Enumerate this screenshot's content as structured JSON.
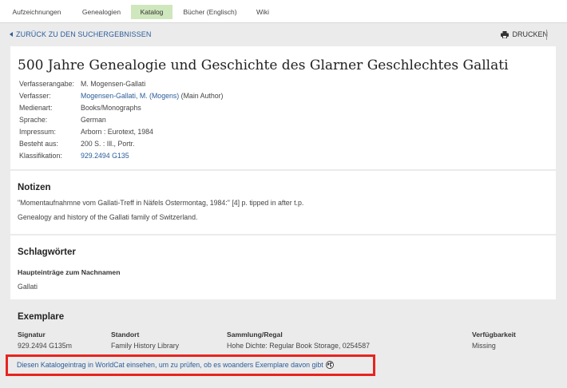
{
  "tabs": [
    {
      "label": "Aufzeichnungen"
    },
    {
      "label": "Genealogien"
    },
    {
      "label": "Katalog"
    },
    {
      "label": "Bücher (Englisch)"
    },
    {
      "label": "Wiki"
    }
  ],
  "active_tab": "Katalog",
  "nav": {
    "back_label": "ZURÜCK ZU DEN SUCHERGEBNISSEN",
    "print_label": "DRUCKEN",
    "print_icon": "printer-icon"
  },
  "record": {
    "title": "500 Jahre Genealogie und Geschichte des Glarner Geschlechtes Gallati",
    "fields": [
      {
        "label": "Verfasserangabe:",
        "value": "M. Mogensen-Gallati"
      },
      {
        "label": "Verfasser:",
        "link": "Mogensen-Gallati, M. (Mogens)",
        "value": " (Main Author)"
      },
      {
        "label": "Medienart:",
        "value": "Books/Monographs"
      },
      {
        "label": "Sprache:",
        "value": "German"
      },
      {
        "label": "Impressum:",
        "value": "Arborn : Eurotext, 1984"
      },
      {
        "label": "Besteht aus:",
        "value": "200 S. : Ill., Portr."
      },
      {
        "label": "Klassifikation:",
        "link": "929.2494 G135"
      }
    ]
  },
  "notes": {
    "heading": "Notizen",
    "lines": [
      "\"Momentaufnahmne vom Gallati-Treff in Näfels Ostermontag, 1984:\" [4] p. tipped in after t.p.",
      "Genealogy and history of the Gallati family of Switzerland."
    ]
  },
  "subjects": {
    "heading": "Schlagwörter",
    "subheading": "Haupteinträge zum Nachnamen",
    "link": "Gallati"
  },
  "copies": {
    "heading": "Exemplare",
    "columns": [
      "Signatur",
      "Standort",
      "Sammlung/Regal",
      "Verfügbarkeit"
    ],
    "row": [
      "929.2494 G135m",
      "Family History Library",
      "Hohe Dichte: Regular Book Storage, 0254587",
      "Missing"
    ]
  },
  "worldcat": {
    "label": "Diesen Katalogeintrag in WorldCat einsehen, um zu prüfen, ob es woanders Exemplare davon gibt",
    "icon": "globe-icon"
  },
  "colors": {
    "link": "#2a5c9a",
    "active_tab": "#cfe7bd",
    "highlight_border": "#e8231f",
    "background": "#ebebeb"
  }
}
